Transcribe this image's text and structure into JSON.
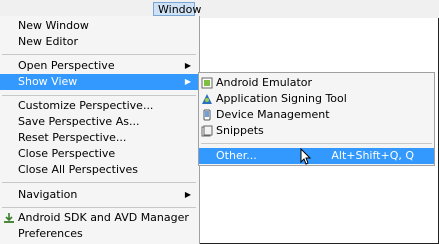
{
  "menubar": {
    "window_label": "Window"
  },
  "window_menu": {
    "items": [
      {
        "label": "New Window"
      },
      {
        "label": "New Editor"
      },
      {
        "label": "Open Perspective"
      },
      {
        "label": "Show View"
      },
      {
        "label": "Customize Perspective..."
      },
      {
        "label": "Save Perspective As..."
      },
      {
        "label": "Reset Perspective..."
      },
      {
        "label": "Close Perspective"
      },
      {
        "label": "Close All Perspectives"
      },
      {
        "label": "Navigation"
      },
      {
        "label": "Android SDK and AVD Manager"
      },
      {
        "label": "Preferences"
      }
    ]
  },
  "show_view_menu": {
    "items": [
      {
        "label": "Android Emulator",
        "icon": "android-emulator-icon"
      },
      {
        "label": "Application Signing Tool",
        "icon": "signing-tool-icon"
      },
      {
        "label": "Device Management",
        "icon": "device-management-icon"
      },
      {
        "label": "Snippets",
        "icon": "snippets-icon"
      },
      {
        "label": "Other...",
        "accelerator": "Alt+Shift+Q, Q"
      }
    ]
  },
  "colors": {
    "highlight": "#3399ff",
    "menu_bg": "#f5f5f5"
  }
}
